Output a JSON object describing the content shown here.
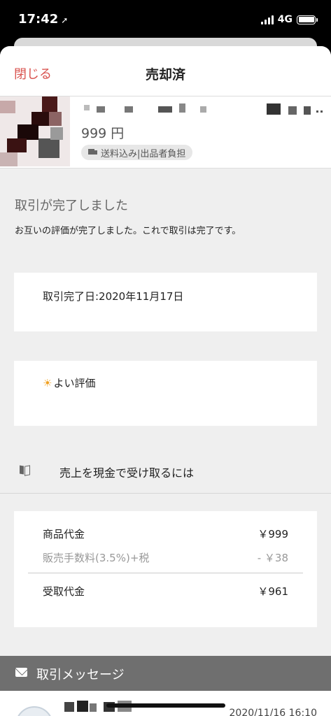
{
  "status_bar": {
    "time": "17:42",
    "location_glyph": "➚",
    "network": "4G"
  },
  "nav": {
    "close_label": "閉じる",
    "title": "売却済"
  },
  "item": {
    "price": "999 円",
    "shipping": "送料込み|出品者負担",
    "shipping_icon": "truck-icon"
  },
  "transaction": {
    "heading": "取引が完了しました",
    "message": "お互いの評価が完了しました。これで取引は完了です。",
    "completion_date": "取引完了日:2020年11月17日",
    "evaluation_icon": "sun-icon",
    "evaluation_glyph": "☀",
    "evaluation": "よい評価"
  },
  "cash_link": {
    "icon": "book-icon",
    "label": "売上を現金で受け取るには"
  },
  "fees": {
    "rows": [
      {
        "label": "商品代金",
        "value": "￥999"
      },
      {
        "label": "販売手数料(3.5%)+税",
        "value": "- ￥38"
      },
      {
        "label": "受取代金",
        "value": "￥961"
      }
    ]
  },
  "messages": {
    "header_icon": "mail-icon",
    "header": "取引メッセージ",
    "first_timestamp": "2020/11/16 16:10"
  },
  "colors": {
    "accent": "#d9534f",
    "sheet_bg": "#efefef",
    "message_bar": "#6f6f6f",
    "evaluation_sun": "#f0a020"
  }
}
